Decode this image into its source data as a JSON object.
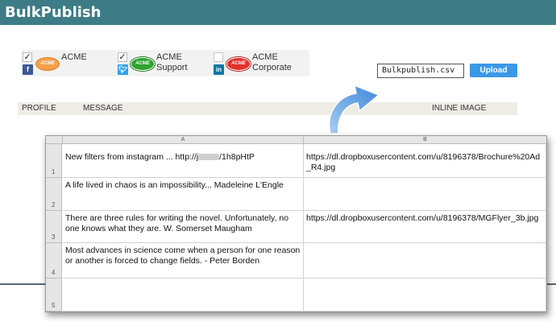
{
  "app": {
    "title": "BulkPublish"
  },
  "profiles": [
    {
      "checked": true,
      "network": "f",
      "label_lines": [
        "ACME"
      ],
      "logo_text": "ACME"
    },
    {
      "checked": true,
      "network": "t",
      "label_lines": [
        "ACME",
        "Support"
      ],
      "logo_text": "ACME"
    },
    {
      "checked": false,
      "network": "in",
      "label_lines": [
        "ACME",
        "Corporate"
      ],
      "logo_text": "ACME"
    }
  ],
  "upload": {
    "file_value": "Bulkpublish.csv",
    "button_label": "Upload"
  },
  "columns": {
    "profile": "PROFILE",
    "message": "MESSAGE",
    "inline_image": "INLINE IMAGE"
  },
  "spreadsheet": {
    "col_headers": [
      "A",
      "B"
    ],
    "rows": [
      {
        "num": "1",
        "a_prefix": "New filters from instagram ... http://j",
        "a_suffix": "/1h8pHtP",
        "b": "https://dl.dropboxusercontent.com/u/8196378/Brochure%20Ad_R4.jpg"
      },
      {
        "num": "2",
        "a": "A life lived in chaos is an impossibility... Madeleine L'Engle",
        "b": ""
      },
      {
        "num": "3",
        "a": "There are three rules for writing the novel. Unfortunately, no one knows what they are. W. Somerset Maugham",
        "b": "https://dl.dropboxusercontent.com/u/8196378/MGFlyer_3b.jpg"
      },
      {
        "num": "4",
        "a": "Most advances in science come when a person for one reason or another is forced to change fields. - Peter Borden",
        "b": ""
      },
      {
        "num": "5",
        "a": "",
        "b": ""
      }
    ]
  },
  "colors": {
    "header_bg": "#3d7c86",
    "accent": "#3b98e6",
    "arrow": "#5b9de0"
  }
}
